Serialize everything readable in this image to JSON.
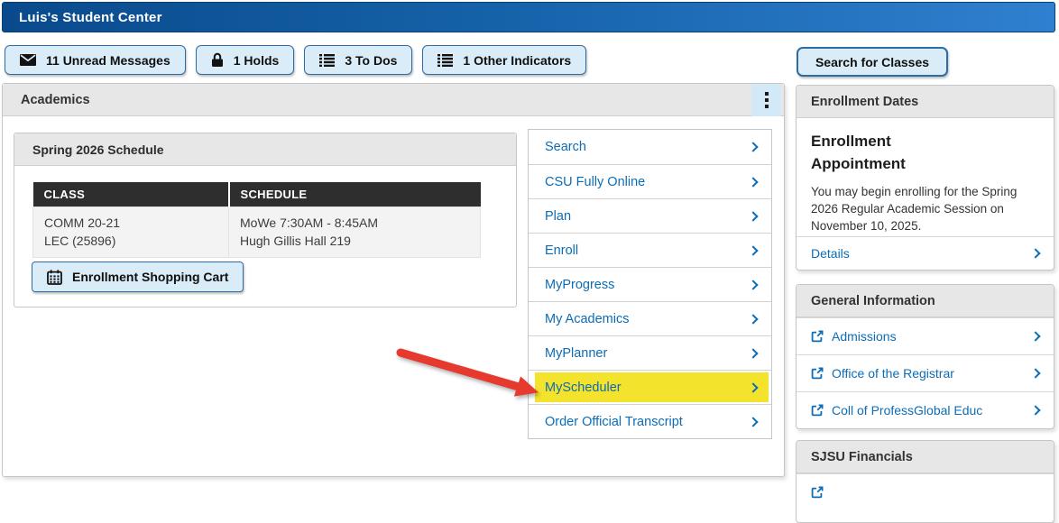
{
  "header": {
    "title": "Luis's Student Center"
  },
  "toolbar": {
    "unread_messages": "11 Unread Messages",
    "holds": "1 Holds",
    "todos": "3 To Dos",
    "other_indicators": "1 Other Indicators",
    "search_for_classes": "Search for Classes"
  },
  "academics": {
    "title": "Academics",
    "schedule_card": {
      "title": "Spring 2026 Schedule",
      "columns": [
        "CLASS",
        "SCHEDULE"
      ],
      "rows": [
        {
          "class_line1": "COMM 20-21",
          "class_line2": "LEC (25896)",
          "schedule_line1": "MoWe 7:30AM - 8:45AM",
          "schedule_line2": "Hugh Gillis Hall 219"
        }
      ],
      "cart_button": "Enrollment Shopping Cart"
    },
    "menu": {
      "items": [
        {
          "label": "Search",
          "highlighted": false
        },
        {
          "label": "CSU Fully Online",
          "highlighted": false
        },
        {
          "label": "Plan",
          "highlighted": false
        },
        {
          "label": "Enroll",
          "highlighted": false
        },
        {
          "label": "MyProgress",
          "highlighted": false
        },
        {
          "label": "My Academics",
          "highlighted": false
        },
        {
          "label": "MyPlanner",
          "highlighted": false
        },
        {
          "label": "MyScheduler",
          "highlighted": true
        },
        {
          "label": "Order Official Transcript",
          "highlighted": false
        }
      ]
    }
  },
  "sidebar": {
    "enrollment_dates": {
      "title": "Enrollment Dates",
      "heading": "Enrollment Appointment",
      "body": "You may begin enrolling for the Spring 2026 Regular Academic Session on November 10, 2025.",
      "details": "Details"
    },
    "general_information": {
      "title": "General Information",
      "links": [
        {
          "label": "Admissions"
        },
        {
          "label": "Office of the Registrar"
        },
        {
          "label": "Coll of ProfessGlobal Educ"
        }
      ]
    },
    "financials": {
      "title": "SJSU Financials"
    }
  },
  "colors": {
    "accent_blue": "#0d6cb5",
    "button_bg": "#d9ecf8",
    "button_border": "#2e6da4",
    "panel_header_bg": "#e7e7e7",
    "table_header_bg": "#2e2e2e",
    "highlight_yellow": "#f4e32c",
    "arrow_red": "#e63a2e",
    "titlebar_gradient_start": "#0a4a8c",
    "titlebar_gradient_end": "#2f80d0"
  }
}
